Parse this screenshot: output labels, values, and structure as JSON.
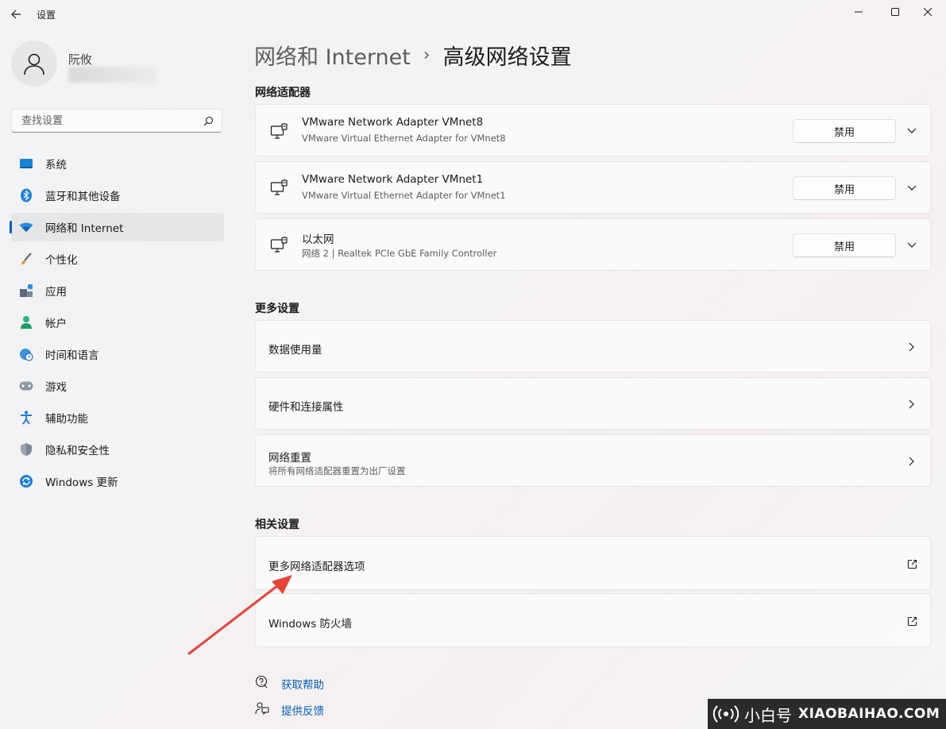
{
  "window": {
    "title": "设置"
  },
  "user": {
    "name": "阮攸"
  },
  "search": {
    "placeholder": "查找设置"
  },
  "sidebar": {
    "items": [
      {
        "label": "系统",
        "icon": "display-icon",
        "active": false
      },
      {
        "label": "蓝牙和其他设备",
        "icon": "bluetooth-icon",
        "active": false
      },
      {
        "label": "网络和 Internet",
        "icon": "wifi-icon",
        "active": true
      },
      {
        "label": "个性化",
        "icon": "brush-icon",
        "active": false
      },
      {
        "label": "应用",
        "icon": "apps-icon",
        "active": false
      },
      {
        "label": "帐户",
        "icon": "person-icon",
        "active": false
      },
      {
        "label": "时间和语言",
        "icon": "globe-clock-icon",
        "active": false
      },
      {
        "label": "游戏",
        "icon": "gamepad-icon",
        "active": false
      },
      {
        "label": "辅助功能",
        "icon": "accessibility-icon",
        "active": false
      },
      {
        "label": "隐私和安全性",
        "icon": "shield-icon",
        "active": false
      },
      {
        "label": "Windows 更新",
        "icon": "update-icon",
        "active": false
      }
    ]
  },
  "breadcrumb": {
    "parent": "网络和 Internet",
    "separator": "›",
    "current": "高级网络设置"
  },
  "sections": {
    "adapters_title": "网络适配器",
    "more_title": "更多设置",
    "related_title": "相关设置"
  },
  "adapters": [
    {
      "name": "VMware Network Adapter VMnet8",
      "desc": "VMware Virtual Ethernet Adapter for VMnet8",
      "button": "禁用"
    },
    {
      "name": "VMware Network Adapter VMnet1",
      "desc": "VMware Virtual Ethernet Adapter for VMnet1",
      "button": "禁用"
    },
    {
      "name": "以太网",
      "desc": "网络 2 | Realtek PCIe GbE Family Controller",
      "button": "禁用"
    }
  ],
  "more_settings": [
    {
      "label": "数据使用量",
      "sub": ""
    },
    {
      "label": "硬件和连接属性",
      "sub": ""
    },
    {
      "label": "网络重置",
      "sub": "将所有网络适配器重置为出厂设置"
    }
  ],
  "related_settings": [
    {
      "label": "更多网络适配器选项"
    },
    {
      "label": "Windows 防火墙"
    }
  ],
  "help": {
    "get_help": "获取帮助",
    "feedback": "提供反馈"
  },
  "watermark": {
    "cn": "小白号",
    "en": "XIAOBAIHAO.COM"
  },
  "colors": {
    "accent": "#005fb8",
    "annotation_arrow": "#e8443a"
  }
}
